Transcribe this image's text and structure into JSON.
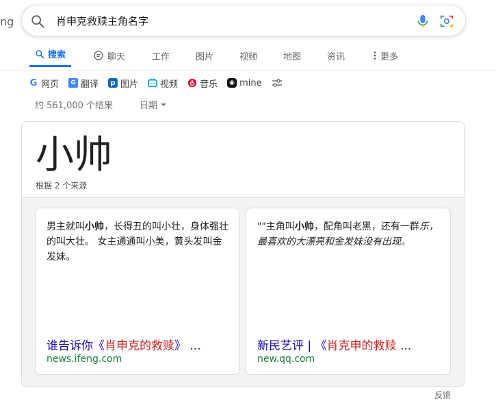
{
  "logo_fragment": "ng",
  "search": {
    "value": "肖申克救赎主角名字"
  },
  "tabs": [
    {
      "label": "搜索",
      "icon": "search-icon",
      "active": true
    },
    {
      "label": "聊天",
      "icon": "chat-icon",
      "active": false
    },
    {
      "label": "工作",
      "icon": "",
      "active": false
    },
    {
      "label": "图片",
      "icon": "",
      "active": false
    },
    {
      "label": "视频",
      "icon": "",
      "active": false
    },
    {
      "label": "地图",
      "icon": "",
      "active": false
    },
    {
      "label": "资讯",
      "icon": "",
      "active": false
    },
    {
      "label": "更多",
      "icon": "more-vert-icon",
      "active": false
    }
  ],
  "filters": [
    {
      "label": "网页",
      "icon": "google-icon"
    },
    {
      "label": "翻译",
      "icon": "translate-icon"
    },
    {
      "label": "图片",
      "icon": "image-icon"
    },
    {
      "label": "视频",
      "icon": "video-icon"
    },
    {
      "label": "音乐",
      "icon": "music-icon"
    },
    {
      "label": "mine",
      "icon": "mine-icon"
    }
  ],
  "results_stats": "约 561,000 个结果",
  "date_filter": "日期",
  "answer": {
    "text": "小帅",
    "source_count": "根据 2 个来源"
  },
  "sources": [
    {
      "snippet_pre": "男主就叫",
      "snippet_bold": "小帅",
      "snippet_post": "，长得丑的叫小壮，身体强壮的叫大壮。 女主通通叫小美，黄头发叫金发妹。",
      "snippet_italic": "",
      "title_pre": "谁告诉你《",
      "title_red": "肖申克的救赎",
      "title_post": "》 ...",
      "url": "news.ifeng.com"
    },
    {
      "snippet_pre": "\"\"主角叫",
      "snippet_bold": "小帅",
      "snippet_post": "，配角叫老黑，还有一群",
      "snippet_italic": "乐，最喜欢的大漂亮和金发妹没有出现。",
      "title_pre": "新民艺评 | 《",
      "title_red": "肖克申的救赎",
      "title_post": " ...",
      "url": "new.qq.com"
    }
  ],
  "feedback": "反馈",
  "colors": {
    "accent": "#1a73e8",
    "link": "#1a0dab",
    "url": "#188038",
    "highlight": "#c5221f"
  }
}
